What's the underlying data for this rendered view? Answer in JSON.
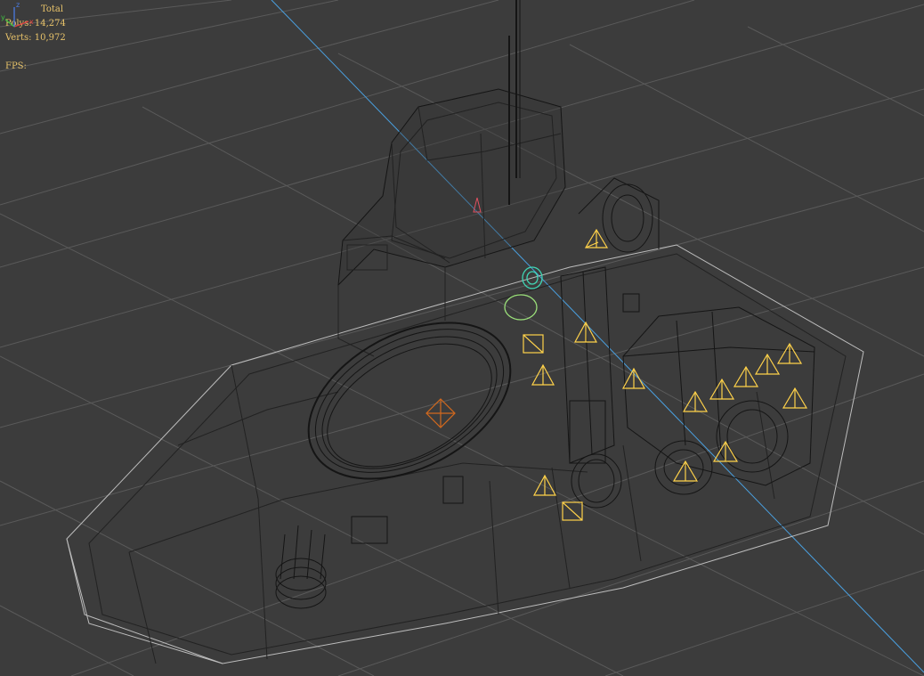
{
  "viewport": {
    "stats": {
      "header": "Total",
      "polys_label": "Polys:",
      "polys_value": "14,274",
      "verts_label": "Verts:",
      "verts_value": "10,972",
      "fps_label": "FPS:",
      "fps_value": ""
    },
    "axis_tripod": {
      "x_label": "x",
      "y_label": "y",
      "z_label": "z"
    },
    "colors": {
      "background": "#3c3c3c",
      "grid": "#5a5a5a",
      "wire": "#111111",
      "wire_light": "#c8c8c8",
      "selection_line": "#4aa0e0",
      "light_gizmo": "#ffd24a",
      "target_gizmo": "#d2691e",
      "camera_gizmo": "#3fd6b4",
      "stats_text": "#e8c36a"
    }
  }
}
